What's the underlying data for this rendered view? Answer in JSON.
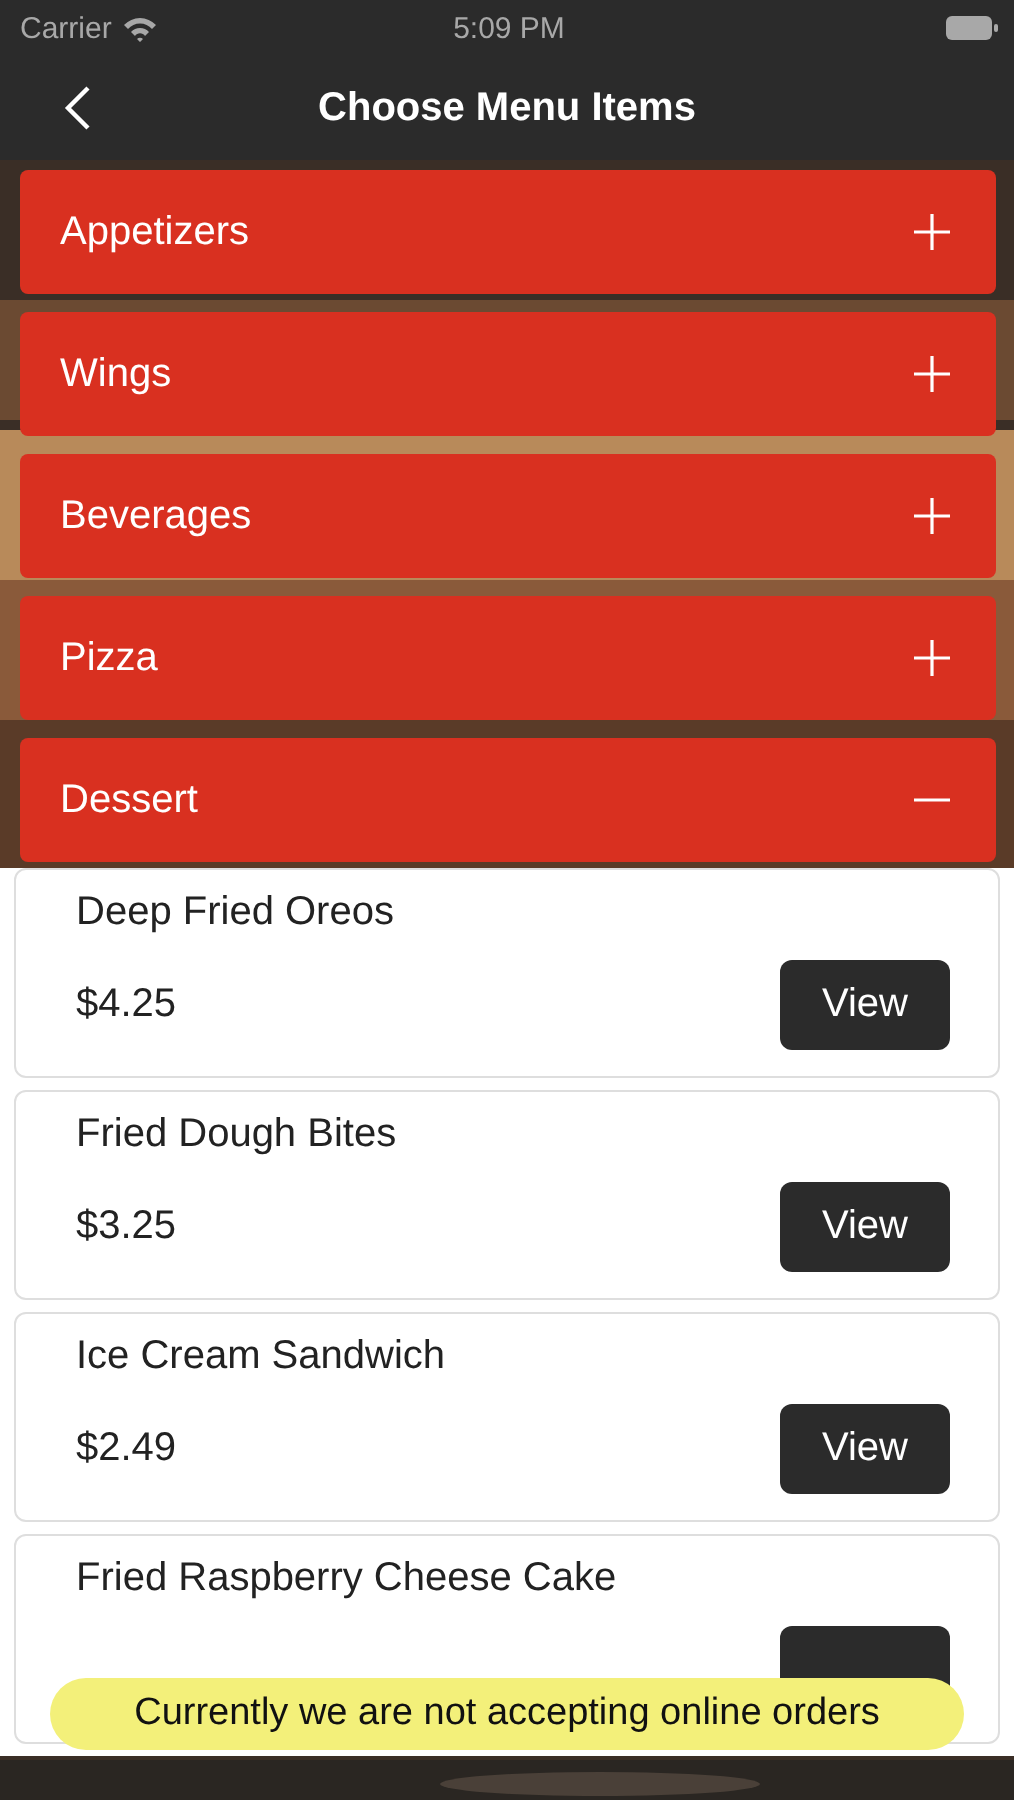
{
  "status_bar": {
    "carrier": "Carrier",
    "time": "5:09 PM"
  },
  "nav": {
    "title": "Choose Menu Items"
  },
  "categories": [
    {
      "label": "Appetizers",
      "expanded": false
    },
    {
      "label": "Wings",
      "expanded": false
    },
    {
      "label": "Beverages",
      "expanded": false
    },
    {
      "label": "Pizza",
      "expanded": false
    },
    {
      "label": "Dessert",
      "expanded": true,
      "items": [
        {
          "name": "Deep Fried Oreos",
          "price": "$4.25",
          "button": "View"
        },
        {
          "name": "Fried Dough Bites",
          "price": "$3.25",
          "button": "View"
        },
        {
          "name": "Ice Cream Sandwich",
          "price": "$2.49",
          "button": "View"
        },
        {
          "name": "Fried Raspberry Cheese Cake"
        }
      ]
    }
  ],
  "notice": "Currently we are not accepting online orders"
}
